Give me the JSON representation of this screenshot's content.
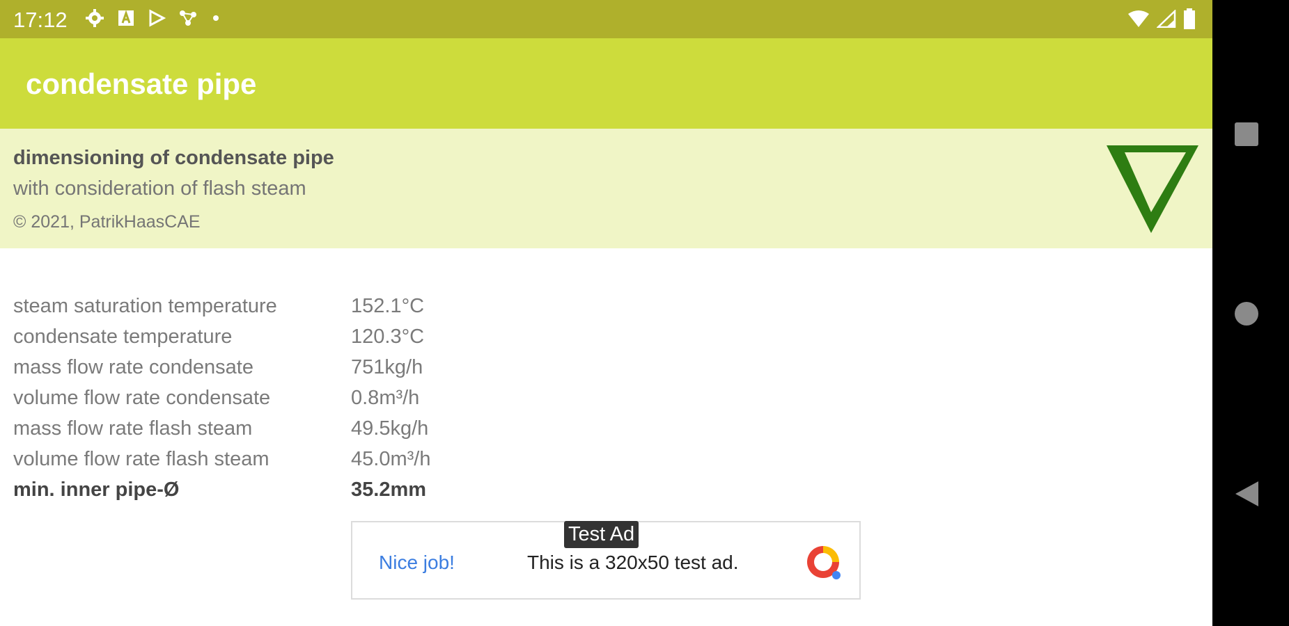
{
  "status": {
    "time": "17:12",
    "icons": [
      "gear-icon",
      "a-icon",
      "play-icon",
      "nodes-icon",
      "dot-icon"
    ],
    "right_icons": [
      "wifi-icon",
      "signal-icon",
      "battery-icon"
    ]
  },
  "app": {
    "title": "condensate pipe"
  },
  "header": {
    "title": "dimensioning of condensate pipe",
    "subtitle": "with consideration of flash steam",
    "copyright": "© 2021, PatrikHaasCAE",
    "logo_icon": "triangle-logo-icon"
  },
  "results": [
    {
      "label": "steam saturation temperature",
      "value": "152.1°C"
    },
    {
      "label": "condensate temperature",
      "value": "120.3°C"
    },
    {
      "label": "mass flow rate condensate",
      "value": "751kg/h"
    },
    {
      "label": "volume flow rate condensate",
      "value": "0.8m³/h"
    },
    {
      "label": "mass flow rate flash steam",
      "value": "49.5kg/h"
    },
    {
      "label": "volume flow rate flash steam",
      "value": "45.0m³/h"
    },
    {
      "label": "min. inner pipe-Ø",
      "value": "35.2mm"
    }
  ],
  "ad": {
    "badge": "Test Ad",
    "headline": "Nice job!",
    "text": "This is a 320x50 test ad."
  },
  "nav": [
    "square-icon",
    "circle-icon",
    "back-triangle-icon"
  ],
  "colors": {
    "status_bar": "#afb02c",
    "app_bar": "#cddc3c",
    "header_bg": "#f0f5c6",
    "logo_green": "#2e7d12",
    "link_blue": "#3b7de0"
  }
}
